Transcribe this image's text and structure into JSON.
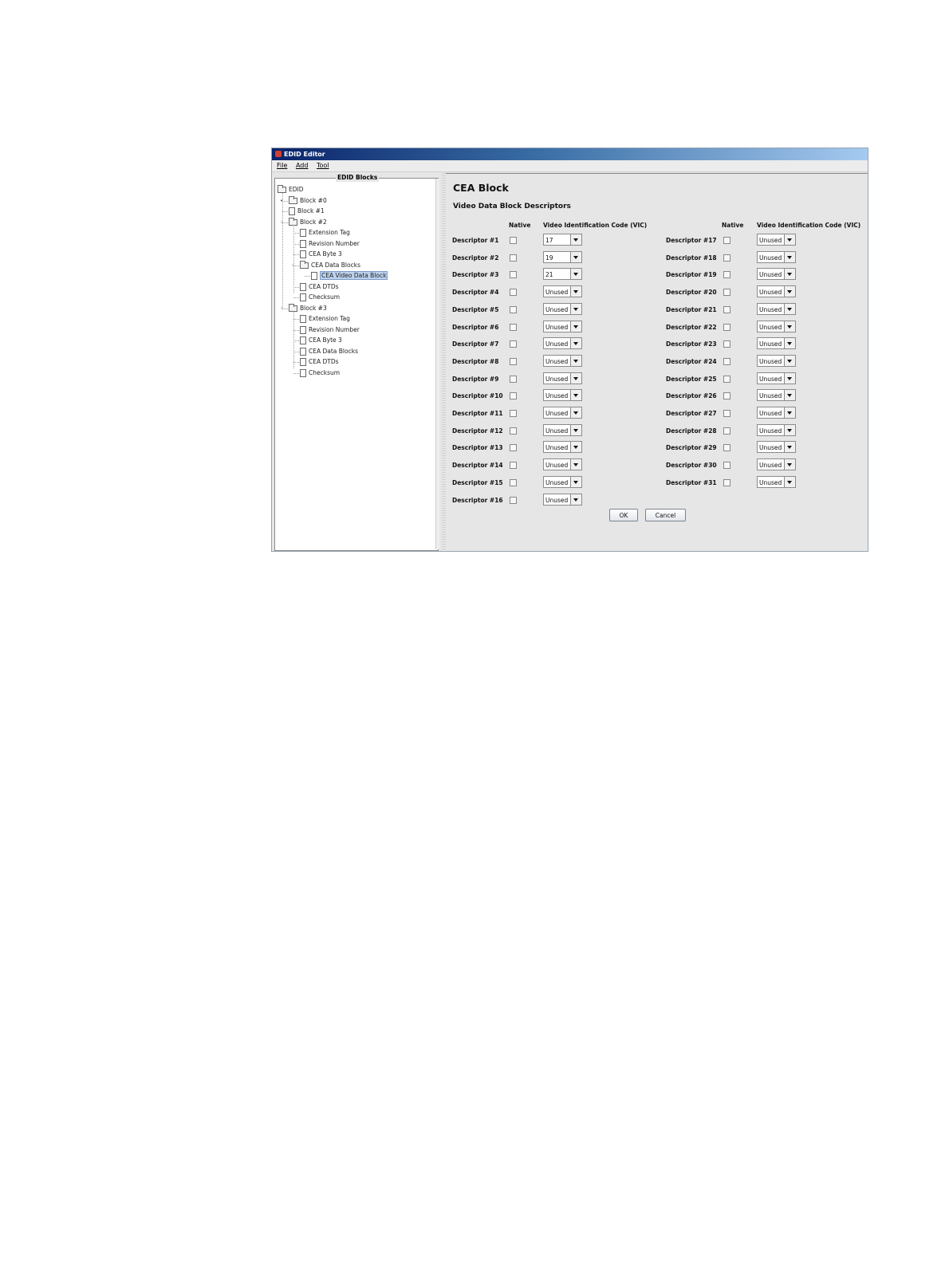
{
  "window": {
    "title": "EDID Editor"
  },
  "menu": [
    {
      "label": "File"
    },
    {
      "label": "Add"
    },
    {
      "label": "Tool"
    }
  ],
  "tree": {
    "legend": "EDID Blocks",
    "nodes": [
      {
        "label": "EDID",
        "type": "folder",
        "depth": 0,
        "expanded": true,
        "selected": false
      },
      {
        "label": "Block #0",
        "type": "folder",
        "depth": 1,
        "expanded": false,
        "selected": false
      },
      {
        "label": "Block #1",
        "type": "doc",
        "depth": 1,
        "expanded": false,
        "selected": false
      },
      {
        "label": "Block #2",
        "type": "folder",
        "depth": 1,
        "expanded": true,
        "selected": false
      },
      {
        "label": "Extension Tag",
        "type": "doc",
        "depth": 2,
        "selected": false
      },
      {
        "label": "Revision Number",
        "type": "doc",
        "depth": 2,
        "selected": false
      },
      {
        "label": "CEA Byte 3",
        "type": "doc",
        "depth": 2,
        "selected": false
      },
      {
        "label": "CEA Data Blocks",
        "type": "folder",
        "depth": 2,
        "expanded": true,
        "selected": false
      },
      {
        "label": "CEA Video Data Block",
        "type": "doc",
        "depth": 3,
        "selected": true
      },
      {
        "label": "CEA DTDs",
        "type": "doc",
        "depth": 2,
        "selected": false
      },
      {
        "label": "Checksum",
        "type": "doc",
        "depth": 2,
        "selected": false
      },
      {
        "label": "Block #3",
        "type": "folder",
        "depth": 1,
        "expanded": true,
        "selected": false
      },
      {
        "label": "Extension Tag",
        "type": "doc",
        "depth": 2,
        "selected": false
      },
      {
        "label": "Revision Number",
        "type": "doc",
        "depth": 2,
        "selected": false
      },
      {
        "label": "CEA Byte 3",
        "type": "doc",
        "depth": 2,
        "selected": false
      },
      {
        "label": "CEA Data Blocks",
        "type": "doc",
        "depth": 2,
        "selected": false
      },
      {
        "label": "CEA DTDs",
        "type": "doc",
        "depth": 2,
        "selected": false
      },
      {
        "label": "Checksum",
        "type": "doc",
        "depth": 2,
        "selected": false
      }
    ]
  },
  "panel": {
    "title": "CEA Block",
    "subtitle": "Video Data Block Descriptors",
    "native_header": "Native",
    "vic_header": "Video Identification Code (VIC)",
    "descriptors": [
      {
        "label": "Descriptor #1",
        "native": false,
        "vic": "17"
      },
      {
        "label": "Descriptor #2",
        "native": false,
        "vic": "19"
      },
      {
        "label": "Descriptor #3",
        "native": false,
        "vic": "21"
      },
      {
        "label": "Descriptor #4",
        "native": false,
        "vic": "Unused"
      },
      {
        "label": "Descriptor #5",
        "native": false,
        "vic": "Unused"
      },
      {
        "label": "Descriptor #6",
        "native": false,
        "vic": "Unused"
      },
      {
        "label": "Descriptor #7",
        "native": false,
        "vic": "Unused"
      },
      {
        "label": "Descriptor #8",
        "native": false,
        "vic": "Unused"
      },
      {
        "label": "Descriptor #9",
        "native": false,
        "vic": "Unused"
      },
      {
        "label": "Descriptor #10",
        "native": false,
        "vic": "Unused"
      },
      {
        "label": "Descriptor #11",
        "native": false,
        "vic": "Unused"
      },
      {
        "label": "Descriptor #12",
        "native": false,
        "vic": "Unused"
      },
      {
        "label": "Descriptor #13",
        "native": false,
        "vic": "Unused"
      },
      {
        "label": "Descriptor #14",
        "native": false,
        "vic": "Unused"
      },
      {
        "label": "Descriptor #15",
        "native": false,
        "vic": "Unused"
      },
      {
        "label": "Descriptor #16",
        "native": false,
        "vic": "Unused"
      },
      {
        "label": "Descriptor #17",
        "native": false,
        "vic": "Unused"
      },
      {
        "label": "Descriptor #18",
        "native": false,
        "vic": "Unused"
      },
      {
        "label": "Descriptor #19",
        "native": false,
        "vic": "Unused"
      },
      {
        "label": "Descriptor #20",
        "native": false,
        "vic": "Unused"
      },
      {
        "label": "Descriptor #21",
        "native": false,
        "vic": "Unused"
      },
      {
        "label": "Descriptor #22",
        "native": false,
        "vic": "Unused"
      },
      {
        "label": "Descriptor #23",
        "native": false,
        "vic": "Unused"
      },
      {
        "label": "Descriptor #24",
        "native": false,
        "vic": "Unused"
      },
      {
        "label": "Descriptor #25",
        "native": false,
        "vic": "Unused"
      },
      {
        "label": "Descriptor #26",
        "native": false,
        "vic": "Unused"
      },
      {
        "label": "Descriptor #27",
        "native": false,
        "vic": "Unused"
      },
      {
        "label": "Descriptor #28",
        "native": false,
        "vic": "Unused"
      },
      {
        "label": "Descriptor #29",
        "native": false,
        "vic": "Unused"
      },
      {
        "label": "Descriptor #30",
        "native": false,
        "vic": "Unused"
      },
      {
        "label": "Descriptor #31",
        "native": false,
        "vic": "Unused"
      }
    ],
    "buttons": {
      "ok": "OK",
      "cancel": "Cancel"
    }
  },
  "colors": {
    "title_gradient_start": "#0a246a",
    "selection": "#bcd2ee",
    "panel_bg": "#e6e6e6"
  }
}
